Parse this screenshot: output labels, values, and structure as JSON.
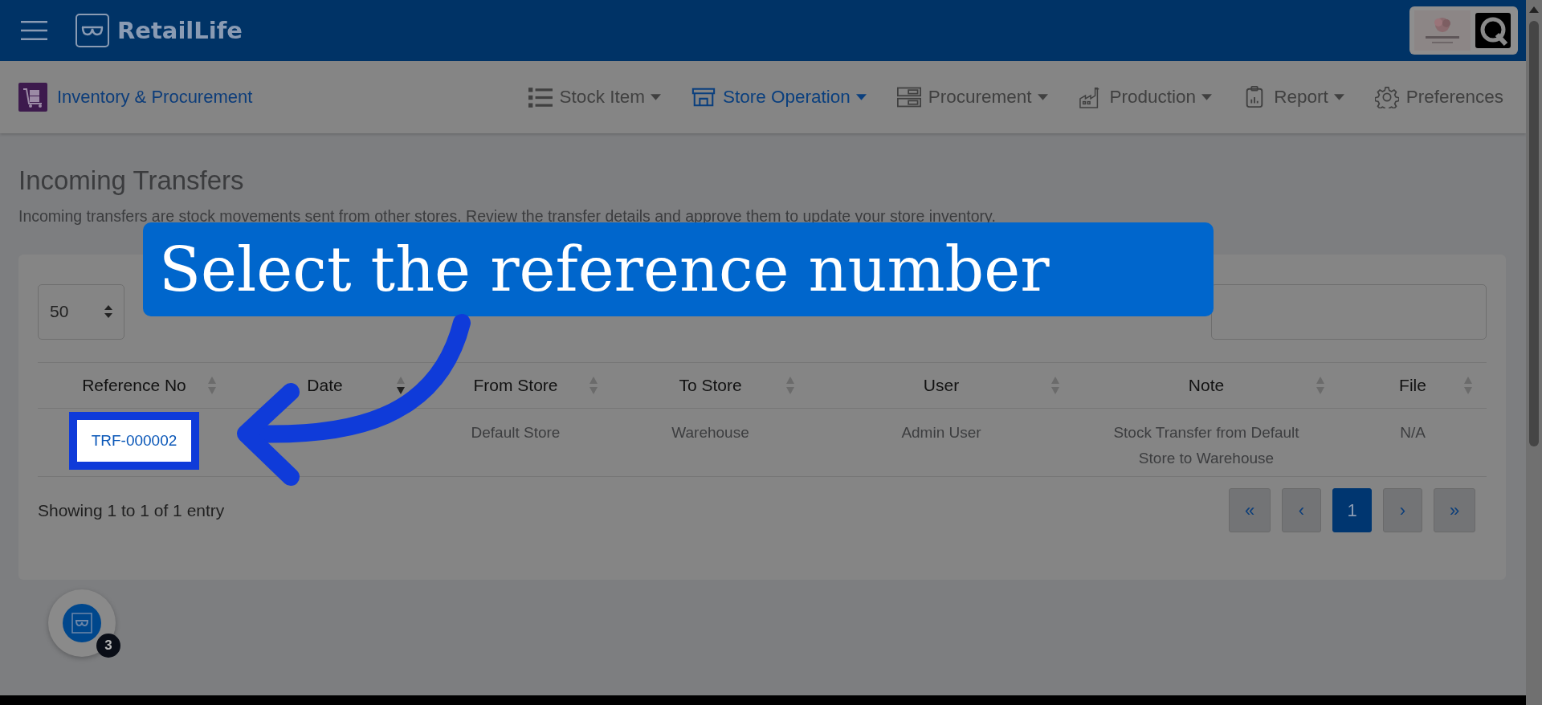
{
  "app": {
    "name": "RetailLife"
  },
  "module": {
    "title": "Inventory & Procurement"
  },
  "nav": [
    {
      "label": "Stock Item",
      "dropdown": true,
      "selected": false
    },
    {
      "label": "Store Operation",
      "dropdown": true,
      "selected": true
    },
    {
      "label": "Procurement",
      "dropdown": true,
      "selected": false
    },
    {
      "label": "Production",
      "dropdown": true,
      "selected": false
    },
    {
      "label": "Report",
      "dropdown": true,
      "selected": false
    },
    {
      "label": "Preferences",
      "dropdown": false,
      "selected": false
    }
  ],
  "page": {
    "title": "Incoming Transfers",
    "description": "Incoming transfers are stock movements sent from other stores. Review the transfer details and approve them to update your store inventory."
  },
  "page_size": {
    "value": "50"
  },
  "table": {
    "columns": [
      {
        "label": "Reference No",
        "sorted": false
      },
      {
        "label": "Date",
        "sorted": true
      },
      {
        "label": "From Store",
        "sorted": false
      },
      {
        "label": "To Store",
        "sorted": false
      },
      {
        "label": "User",
        "sorted": false
      },
      {
        "label": "Note",
        "sorted": false
      },
      {
        "label": "File",
        "sorted": false
      }
    ],
    "rows": [
      {
        "highlighted": true,
        "cells": [
          "TRF-000002",
          "",
          "Default Store",
          "Warehouse",
          "Admin User",
          "Stock Transfer from Default Store to Warehouse",
          "N/A"
        ]
      }
    ]
  },
  "info": "Showing 1 to 1 of 1 entry",
  "pagination": [
    {
      "label": "«",
      "selected": false
    },
    {
      "label": "‹",
      "selected": false
    },
    {
      "label": "1",
      "selected": true
    },
    {
      "label": "›",
      "selected": false
    },
    {
      "label": "»",
      "selected": false
    }
  ],
  "callout": {
    "text": "Select the reference number"
  },
  "helper": {
    "badge": "3"
  }
}
